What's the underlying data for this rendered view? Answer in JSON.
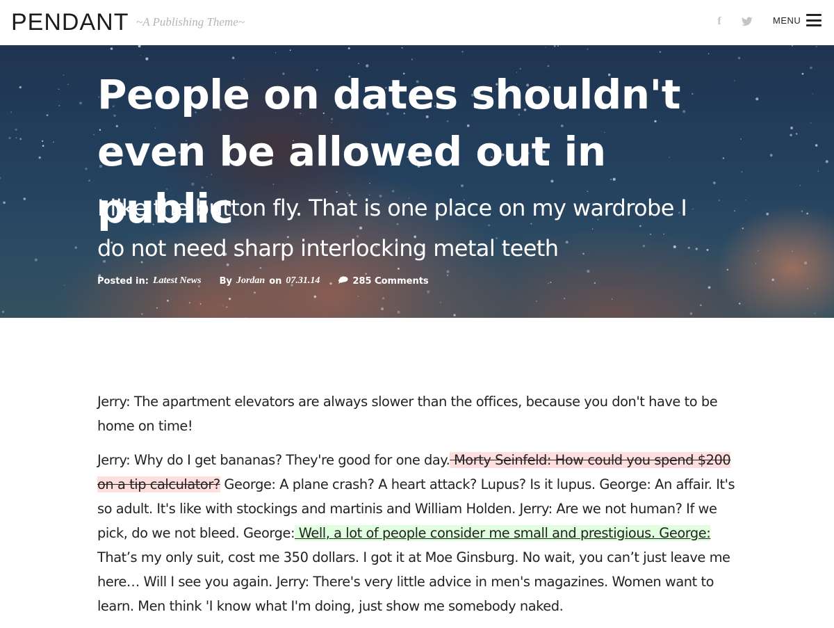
{
  "site": {
    "brand": "PENDANT",
    "tagline": "~A Publishing Theme~"
  },
  "header": {
    "menu_label": "MENU",
    "icons": [
      "facebook-icon",
      "twitter-icon",
      "hamburger-menu-icon"
    ]
  },
  "post": {
    "title": "People on dates shouldn't even be allowed out in public",
    "subtitle": "I like the button fly. That is one place on my wardrobe I do not need sharp interlocking metal teeth",
    "meta": {
      "posted_in_label": "Posted in:",
      "category": "Latest News",
      "by_label": "By",
      "author": "Jordan",
      "on_label": "on",
      "date": "07.31.14",
      "comments": "285 Comments"
    }
  },
  "content": {
    "p1": "Jerry: The apartment elevators are always slower than the offices, because you don't have to be home on time!",
    "p2_before": "Jerry: Why do I get bananas? They're good for one day.",
    "p2_deleted": " Morty Seinfeld: How could you spend $200 on a tip calculator?",
    "p2_middle": " George: A plane crash? A heart attack? Lupus? Is it lupus. George: An affair. It's so adult. It's like with stockings and martinis and William Holden. Jerry: Are we not human? If we pick, do we not bleed. George:",
    "p2_inserted": " Well, a lot of people consider me small and prestigious. George:",
    "p2_after": " That’s my only suit, cost me 350 dollars. I got it at Moe Ginsburg. No wait, you can’t just leave me here… Will I see you again. Jerry: There's very little advice in men's magazines. Women want to learn. Men think 'I know what I'm doing, just show me somebody naked."
  },
  "colors": {
    "deleted_bg": "#ffdede",
    "inserted_bg": "#dfffdf",
    "tagline": "#b5b5b5",
    "social_icons": "#c4c4c4"
  }
}
